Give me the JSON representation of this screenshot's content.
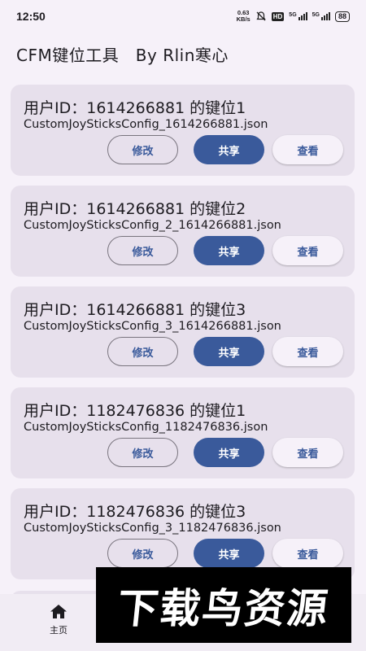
{
  "status_bar": {
    "time": "12:50",
    "net_speed_value": "0.63",
    "net_speed_unit": "KB/s",
    "hd_badge": "HD",
    "signal1_label": "5G",
    "signal2_label": "5G",
    "battery": "88",
    "icons": [
      "mute-icon",
      "signal-icon",
      "battery-icon"
    ]
  },
  "app": {
    "title": "CFM键位工具   By Rlin寒心"
  },
  "buttons": {
    "edit": "修改",
    "share": "共享",
    "view": "查看"
  },
  "configs": [
    {
      "title": "用户ID：1614266881 的键位1",
      "file": "CustomJoySticksConfig_1614266881.json"
    },
    {
      "title": "用户ID：1614266881 的键位2",
      "file": "CustomJoySticksConfig_2_1614266881.json"
    },
    {
      "title": "用户ID：1614266881 的键位3",
      "file": "CustomJoySticksConfig_3_1614266881.json"
    },
    {
      "title": "用户ID：1182476836 的键位1",
      "file": "CustomJoySticksConfig_1182476836.json"
    },
    {
      "title": "用户ID：1182476836 的键位3",
      "file": "CustomJoySticksConfig_3_1182476836.json"
    }
  ],
  "bottom_nav": {
    "home_label": "主页",
    "home_icon": "home-icon"
  },
  "watermark": {
    "text": "下载鸟资源"
  },
  "colors": {
    "accent": "#3a5a9b",
    "card_bg": "#e7e0ec",
    "page_bg": "#f6f1f9"
  }
}
